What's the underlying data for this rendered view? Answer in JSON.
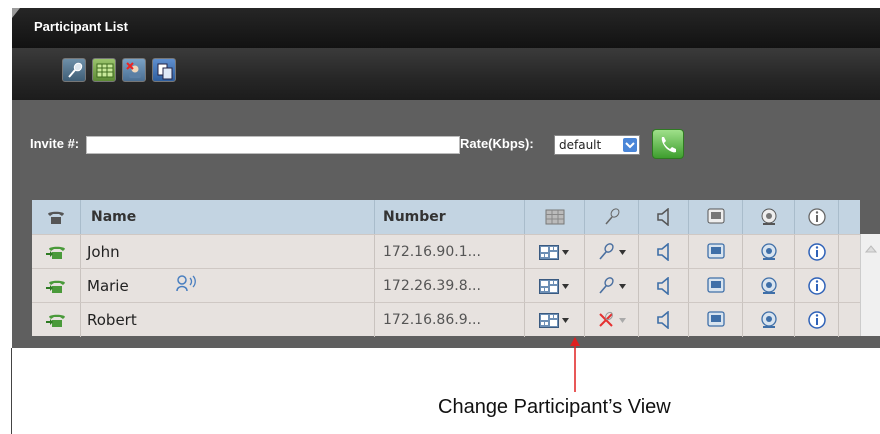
{
  "panel": {
    "title": "Participant List",
    "toolbar": {
      "buttons": [
        {
          "icon": "microphone-icon"
        },
        {
          "icon": "layout-grid-icon"
        },
        {
          "icon": "remove-participant-icon"
        },
        {
          "icon": "copy-icon"
        }
      ]
    }
  },
  "invite": {
    "label": "Invite #:",
    "value": "",
    "rate_label": "Rate(Kbps):",
    "rate_value": "default",
    "call_icon": "phone-call-icon"
  },
  "table": {
    "headers": {
      "type_icon": "phone-icon",
      "name": "Name",
      "number": "Number",
      "layout_icon": "layout-grid-icon",
      "mic_icon": "microphone-icon",
      "speaker_icon": "speaker-icon",
      "screen_icon": "screen-icon",
      "camera_icon": "camera-icon",
      "info_icon": "info-icon"
    },
    "rows": [
      {
        "name": "John",
        "number": "172.16.90.1...",
        "speaking": false,
        "mic_muted": false
      },
      {
        "name": "Marie",
        "number": "172.26.39.8...",
        "speaking": true,
        "mic_muted": false
      },
      {
        "name": "Robert",
        "number": "172.16.86.9...",
        "speaking": false,
        "mic_muted": true
      }
    ]
  },
  "annotation": {
    "text": "Change Participant’s View",
    "color": "#e02020"
  },
  "colors": {
    "header_bg": "#c3d4e2",
    "row_bg": "#e7e2df",
    "panel_bg": "#5f5f5f",
    "titlebar_bg": "#1e1e1e"
  }
}
